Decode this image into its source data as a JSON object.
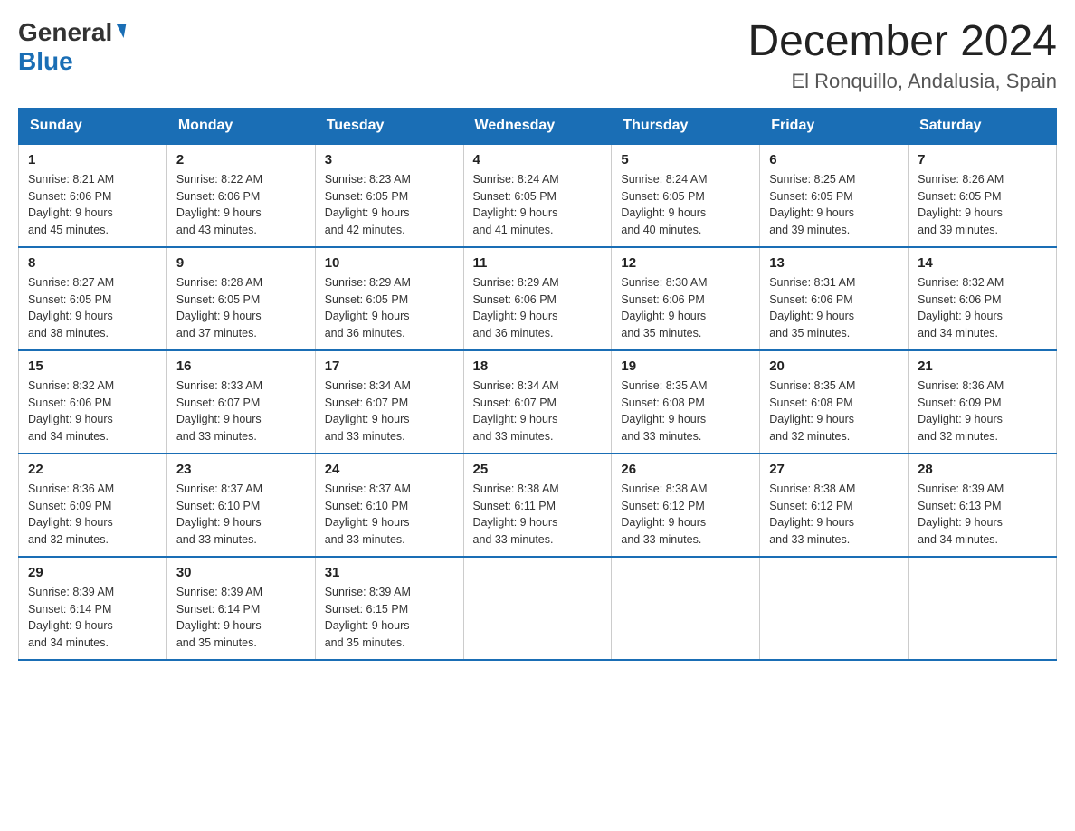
{
  "logo": {
    "general_text": "General",
    "blue_text": "Blue"
  },
  "title": {
    "month_year": "December 2024",
    "location": "El Ronquillo, Andalusia, Spain"
  },
  "headers": [
    "Sunday",
    "Monday",
    "Tuesday",
    "Wednesday",
    "Thursday",
    "Friday",
    "Saturday"
  ],
  "weeks": [
    [
      {
        "day": "1",
        "sunrise": "8:21 AM",
        "sunset": "6:06 PM",
        "daylight": "9 hours and 45 minutes."
      },
      {
        "day": "2",
        "sunrise": "8:22 AM",
        "sunset": "6:06 PM",
        "daylight": "9 hours and 43 minutes."
      },
      {
        "day": "3",
        "sunrise": "8:23 AM",
        "sunset": "6:05 PM",
        "daylight": "9 hours and 42 minutes."
      },
      {
        "day": "4",
        "sunrise": "8:24 AM",
        "sunset": "6:05 PM",
        "daylight": "9 hours and 41 minutes."
      },
      {
        "day": "5",
        "sunrise": "8:24 AM",
        "sunset": "6:05 PM",
        "daylight": "9 hours and 40 minutes."
      },
      {
        "day": "6",
        "sunrise": "8:25 AM",
        "sunset": "6:05 PM",
        "daylight": "9 hours and 39 minutes."
      },
      {
        "day": "7",
        "sunrise": "8:26 AM",
        "sunset": "6:05 PM",
        "daylight": "9 hours and 39 minutes."
      }
    ],
    [
      {
        "day": "8",
        "sunrise": "8:27 AM",
        "sunset": "6:05 PM",
        "daylight": "9 hours and 38 minutes."
      },
      {
        "day": "9",
        "sunrise": "8:28 AM",
        "sunset": "6:05 PM",
        "daylight": "9 hours and 37 minutes."
      },
      {
        "day": "10",
        "sunrise": "8:29 AM",
        "sunset": "6:05 PM",
        "daylight": "9 hours and 36 minutes."
      },
      {
        "day": "11",
        "sunrise": "8:29 AM",
        "sunset": "6:06 PM",
        "daylight": "9 hours and 36 minutes."
      },
      {
        "day": "12",
        "sunrise": "8:30 AM",
        "sunset": "6:06 PM",
        "daylight": "9 hours and 35 minutes."
      },
      {
        "day": "13",
        "sunrise": "8:31 AM",
        "sunset": "6:06 PM",
        "daylight": "9 hours and 35 minutes."
      },
      {
        "day": "14",
        "sunrise": "8:32 AM",
        "sunset": "6:06 PM",
        "daylight": "9 hours and 34 minutes."
      }
    ],
    [
      {
        "day": "15",
        "sunrise": "8:32 AM",
        "sunset": "6:06 PM",
        "daylight": "9 hours and 34 minutes."
      },
      {
        "day": "16",
        "sunrise": "8:33 AM",
        "sunset": "6:07 PM",
        "daylight": "9 hours and 33 minutes."
      },
      {
        "day": "17",
        "sunrise": "8:34 AM",
        "sunset": "6:07 PM",
        "daylight": "9 hours and 33 minutes."
      },
      {
        "day": "18",
        "sunrise": "8:34 AM",
        "sunset": "6:07 PM",
        "daylight": "9 hours and 33 minutes."
      },
      {
        "day": "19",
        "sunrise": "8:35 AM",
        "sunset": "6:08 PM",
        "daylight": "9 hours and 33 minutes."
      },
      {
        "day": "20",
        "sunrise": "8:35 AM",
        "sunset": "6:08 PM",
        "daylight": "9 hours and 32 minutes."
      },
      {
        "day": "21",
        "sunrise": "8:36 AM",
        "sunset": "6:09 PM",
        "daylight": "9 hours and 32 minutes."
      }
    ],
    [
      {
        "day": "22",
        "sunrise": "8:36 AM",
        "sunset": "6:09 PM",
        "daylight": "9 hours and 32 minutes."
      },
      {
        "day": "23",
        "sunrise": "8:37 AM",
        "sunset": "6:10 PM",
        "daylight": "9 hours and 33 minutes."
      },
      {
        "day": "24",
        "sunrise": "8:37 AM",
        "sunset": "6:10 PM",
        "daylight": "9 hours and 33 minutes."
      },
      {
        "day": "25",
        "sunrise": "8:38 AM",
        "sunset": "6:11 PM",
        "daylight": "9 hours and 33 minutes."
      },
      {
        "day": "26",
        "sunrise": "8:38 AM",
        "sunset": "6:12 PM",
        "daylight": "9 hours and 33 minutes."
      },
      {
        "day": "27",
        "sunrise": "8:38 AM",
        "sunset": "6:12 PM",
        "daylight": "9 hours and 33 minutes."
      },
      {
        "day": "28",
        "sunrise": "8:39 AM",
        "sunset": "6:13 PM",
        "daylight": "9 hours and 34 minutes."
      }
    ],
    [
      {
        "day": "29",
        "sunrise": "8:39 AM",
        "sunset": "6:14 PM",
        "daylight": "9 hours and 34 minutes."
      },
      {
        "day": "30",
        "sunrise": "8:39 AM",
        "sunset": "6:14 PM",
        "daylight": "9 hours and 35 minutes."
      },
      {
        "day": "31",
        "sunrise": "8:39 AM",
        "sunset": "6:15 PM",
        "daylight": "9 hours and 35 minutes."
      },
      null,
      null,
      null,
      null
    ]
  ],
  "labels": {
    "sunrise": "Sunrise:",
    "sunset": "Sunset:",
    "daylight": "Daylight:"
  }
}
